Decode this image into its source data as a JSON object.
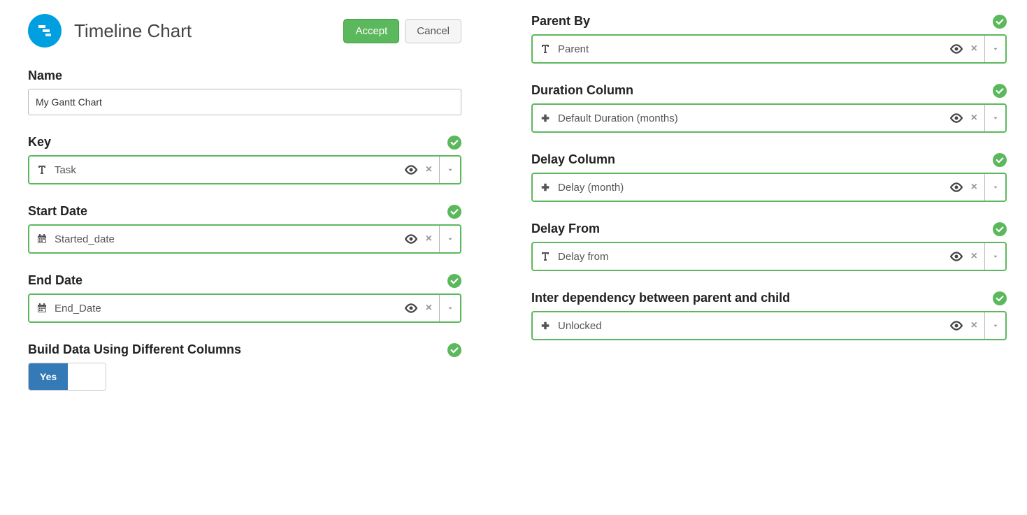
{
  "header": {
    "title": "Timeline Chart",
    "accept_label": "Accept",
    "cancel_label": "Cancel"
  },
  "left": {
    "name": {
      "label": "Name",
      "value": "My Gantt Chart"
    },
    "key": {
      "label": "Key",
      "value": "Task",
      "icon": "text"
    },
    "start_date": {
      "label": "Start Date",
      "value": "Started_date",
      "icon": "calendar"
    },
    "end_date": {
      "label": "End Date",
      "value": "End_Date",
      "icon": "calendar"
    },
    "build_diff": {
      "label": "Build Data Using Different Columns",
      "toggle_value": "Yes"
    }
  },
  "right": {
    "parent_by": {
      "label": "Parent By",
      "value": "Parent",
      "icon": "text"
    },
    "duration": {
      "label": "Duration Column",
      "value": "Default Duration (months)",
      "icon": "plus"
    },
    "delay_col": {
      "label": "Delay Column",
      "value": "Delay (month)",
      "icon": "plus"
    },
    "delay_from": {
      "label": "Delay From",
      "value": "Delay from",
      "icon": "text"
    },
    "inter_dep": {
      "label": "Inter dependency between parent and child",
      "value": "Unlocked",
      "icon": "plus"
    }
  }
}
